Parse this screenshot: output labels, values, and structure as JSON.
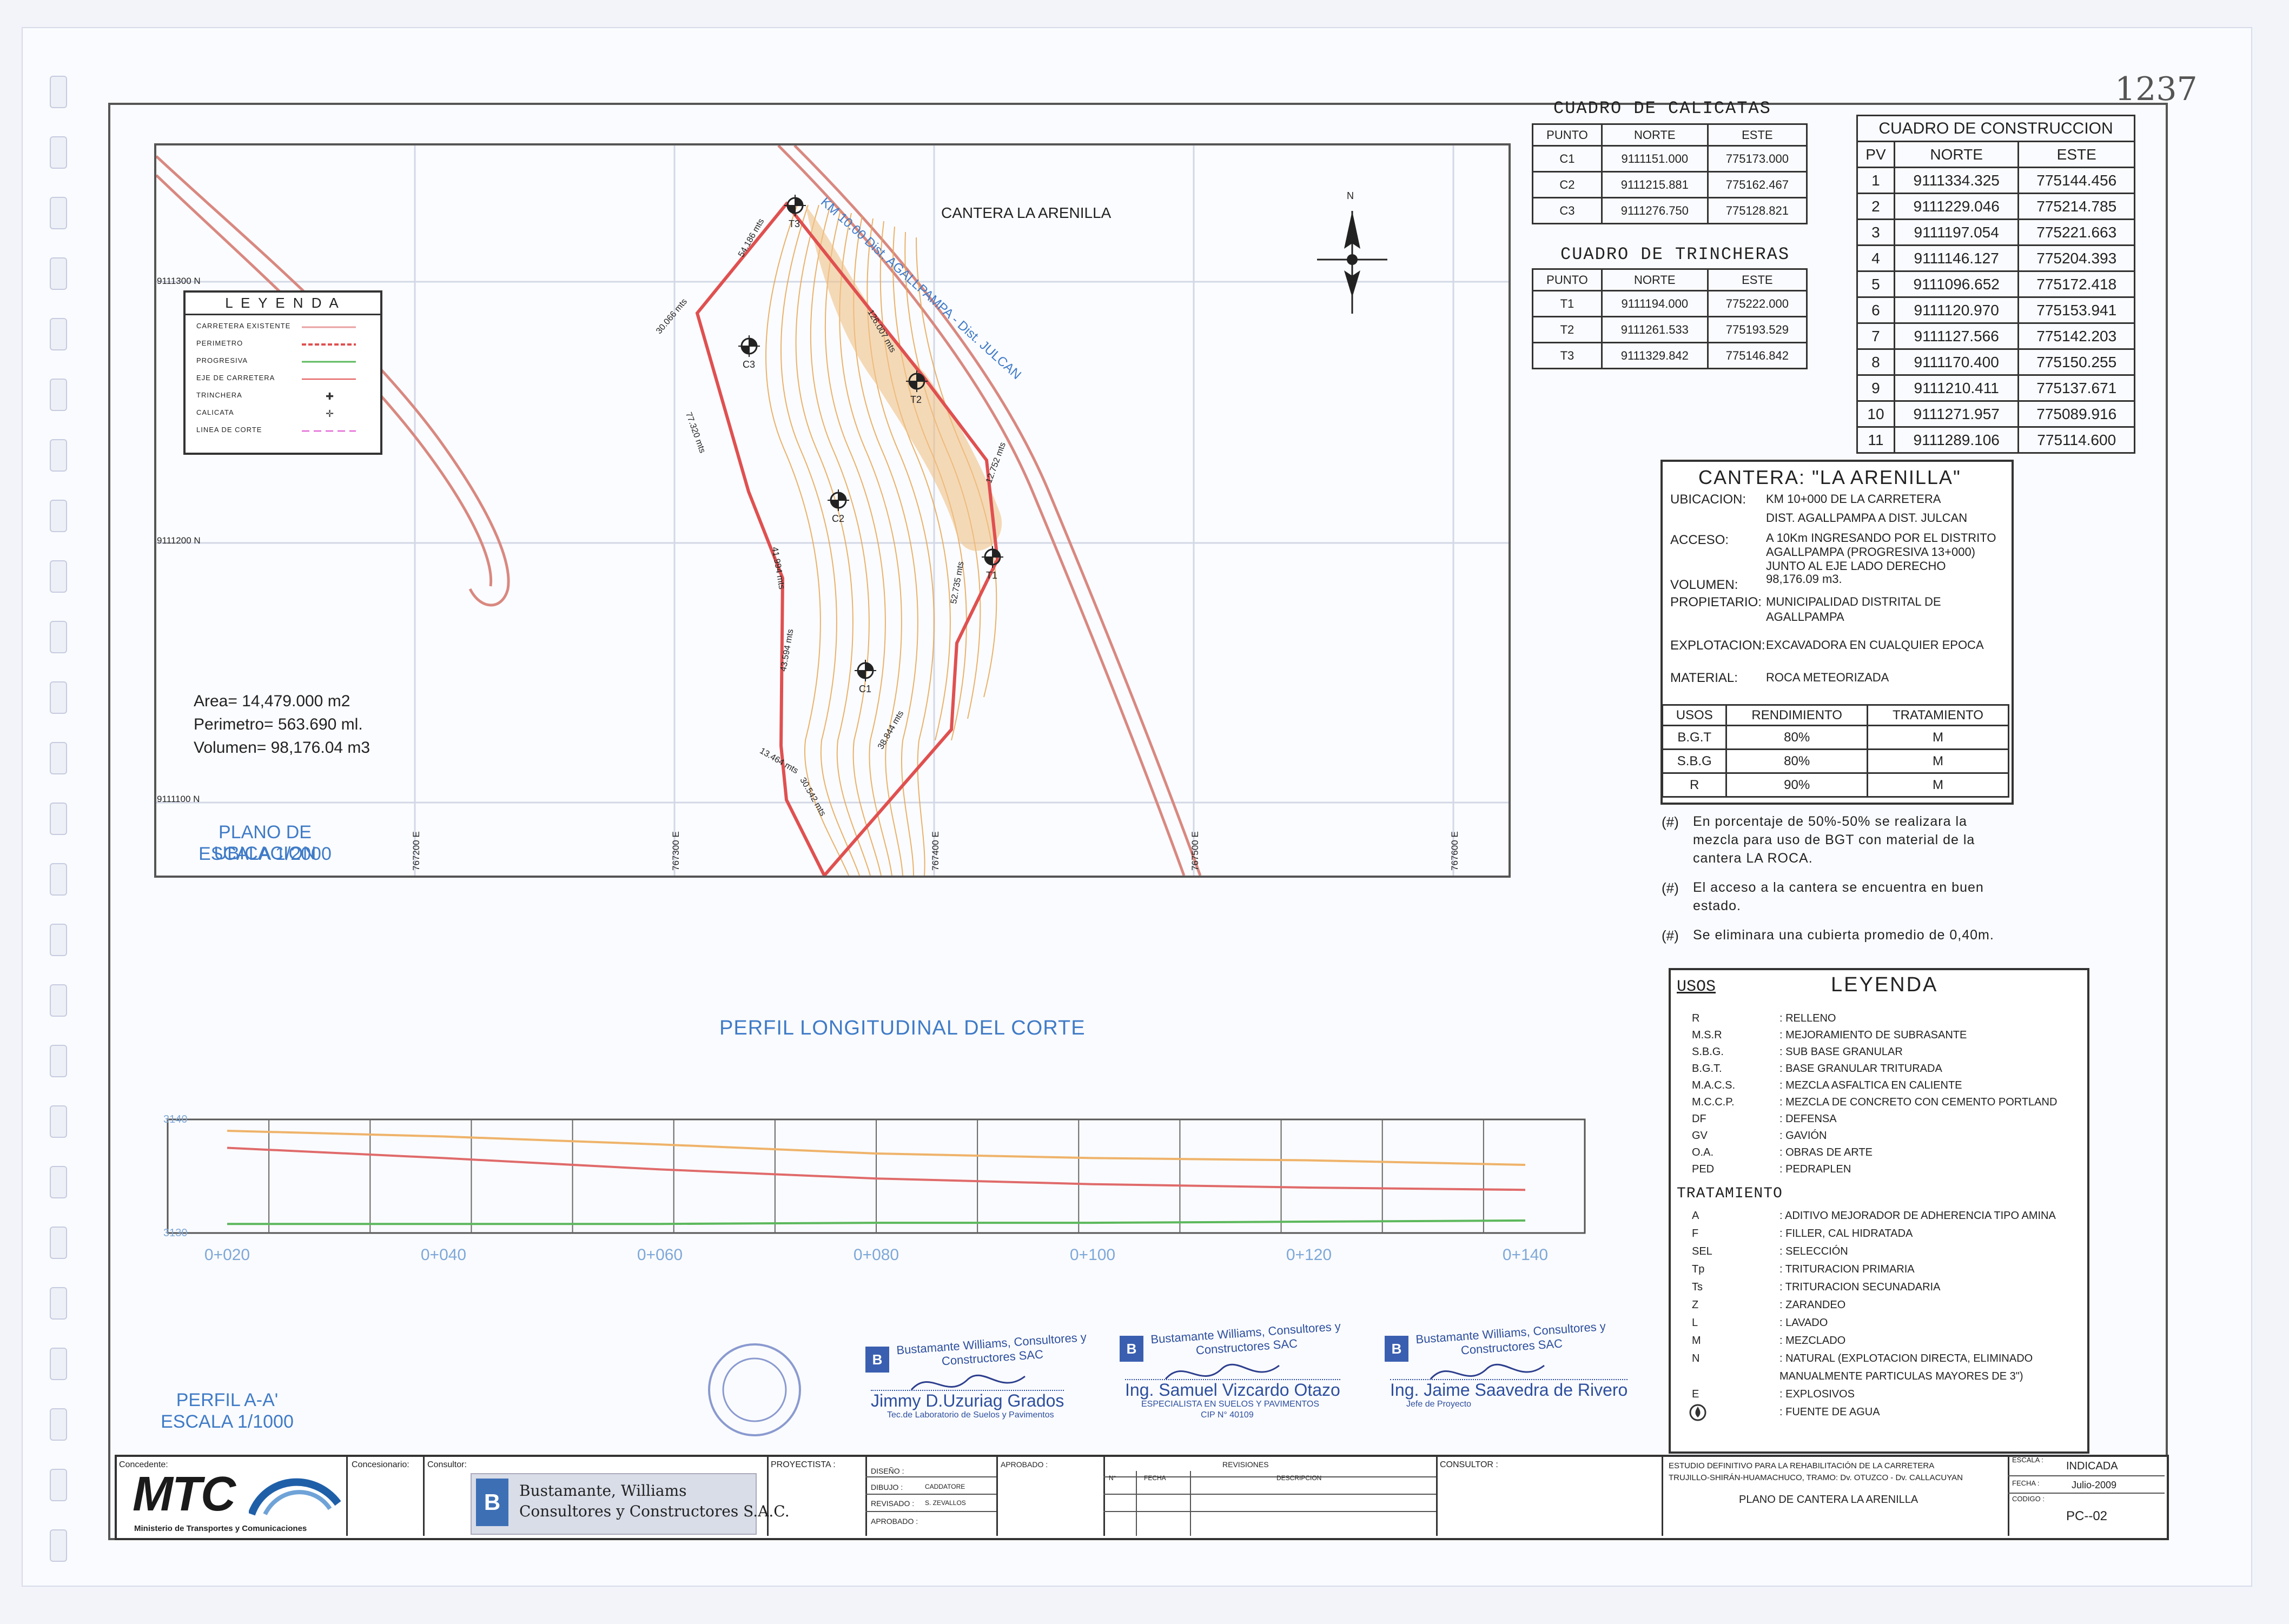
{
  "sheet_number": "1237",
  "calicatas": {
    "title": "CUADRO DE CALICATAS",
    "headers": [
      "PUNTO",
      "NORTE",
      "ESTE"
    ],
    "rows": [
      [
        "C1",
        "9111151.000",
        "775173.000"
      ],
      [
        "C2",
        "9111215.881",
        "775162.467"
      ],
      [
        "C3",
        "9111276.750",
        "775128.821"
      ]
    ]
  },
  "trincheras": {
    "title": "CUADRO DE TRINCHERAS",
    "headers": [
      "PUNTO",
      "NORTE",
      "ESTE"
    ],
    "rows": [
      [
        "T1",
        "9111194.000",
        "775222.000"
      ],
      [
        "T2",
        "9111261.533",
        "775193.529"
      ],
      [
        "T3",
        "9111329.842",
        "775146.842"
      ]
    ]
  },
  "construccion": {
    "title": "CUADRO DE CONSTRUCCION",
    "headers": [
      "PV",
      "NORTE",
      "ESTE"
    ],
    "rows": [
      [
        "1",
        "9111334.325",
        "775144.456"
      ],
      [
        "2",
        "9111229.046",
        "775214.785"
      ],
      [
        "3",
        "9111197.054",
        "775221.663"
      ],
      [
        "4",
        "9111146.127",
        "775204.393"
      ],
      [
        "5",
        "9111096.652",
        "775172.418"
      ],
      [
        "6",
        "9111120.970",
        "775153.941"
      ],
      [
        "7",
        "9111127.566",
        "775142.203"
      ],
      [
        "8",
        "9111170.400",
        "775150.255"
      ],
      [
        "9",
        "9111210.411",
        "775137.671"
      ],
      [
        "10",
        "9111271.957",
        "775089.916"
      ],
      [
        "11",
        "9111289.106",
        "775114.600"
      ]
    ]
  },
  "map": {
    "quarry_label": "CANTERA LA ARENILLA",
    "road_label": "KM 10.00 Dist. AGALLPAMPA - Dist. JULCAN",
    "north": "N",
    "grid_n": [
      "9111300 N",
      "9111200 N",
      "9111100 N"
    ],
    "grid_e": [
      "767200 E",
      "767300 E",
      "767400 E",
      "767500 E",
      "767600 E"
    ],
    "points": [
      "T3",
      "T2",
      "T1",
      "C3",
      "C2",
      "C1"
    ],
    "edge_labels": [
      "54.186 mts",
      "30.066 mts",
      "77.320 mts",
      "41.994 mts",
      "43.594 mts",
      "13.464 mts",
      "30.542 mts",
      "38.844 mts",
      "52.735 mts",
      "12.752 mts",
      "126.007 mts"
    ],
    "area": "Area= 14,479.000 m2",
    "perimetro": "Perimetro= 563.690 ml.",
    "volumen": "Volumen= 98,176.04 m3",
    "plano_title": "PLANO DE UBICACION",
    "plano_scale": "ESCALA 1/2000"
  },
  "map_legend": {
    "title": "L E Y E N D A",
    "items": [
      "CARRETERA EXISTENTE",
      "PERIMETRO",
      "PROGRESIVA",
      "EJE DE CARRETERA",
      "TRINCHERA",
      "CALICATA",
      "LINEA DE CORTE"
    ]
  },
  "cantera": {
    "title": "CANTERA:  \"LA ARENILLA\"",
    "ubicacion_label": "UBICACION:",
    "ubicacion": [
      "KM 10+000 DE LA CARRETERA",
      "DIST. AGALLPAMPA A DIST. JULCAN"
    ],
    "acceso_label": "ACCESO:",
    "acceso": [
      "A 10Km INGRESANDO POR EL DISTRITO",
      "AGALLPAMPA (PROGRESIVA 13+000)",
      "JUNTO AL EJE LADO DERECHO"
    ],
    "volumen_label": "VOLUMEN:",
    "volumen": "98,176.09  m3.",
    "propietario_label": "PROPIETARIO:",
    "propietario": [
      "MUNICIPALIDAD DISTRITAL DE",
      "AGALLPAMPA"
    ],
    "explotacion_label": "EXPLOTACION:",
    "explotacion": "EXCAVADORA EN CUALQUIER EPOCA",
    "material_label": "MATERIAL:",
    "material": "ROCA METEORIZADA",
    "usos_headers": [
      "USOS",
      "RENDIMIENTO",
      "TRATAMIENTO"
    ],
    "usos_rows": [
      [
        "B.G.T",
        "80%",
        "M"
      ],
      [
        "S.B.G",
        "80%",
        "M"
      ],
      [
        "R",
        "90%",
        "M"
      ]
    ]
  },
  "notes": [
    [
      "(#)",
      "En porcentaje de 50%-50% se realizara la",
      "mezcla para uso de BGT con material de la",
      "cantera LA ROCA."
    ],
    [
      "(#)",
      "El acceso a la cantera se encuentra en buen",
      "estado."
    ],
    [
      "(#)",
      "Se eliminara una cubierta promedio de 0,40m."
    ]
  ],
  "profile": {
    "title": "PERFIL LONGITUDINAL DEL CORTE",
    "y_labels": [
      "3140",
      "3130"
    ],
    "stations": [
      "0+020",
      "0+040",
      "0+060",
      "0+080",
      "0+100",
      "0+120",
      "0+140"
    ],
    "section_title": "PERFIL A-A'",
    "section_scale": "ESCALA 1/1000"
  },
  "chart_data": {
    "type": "line",
    "x": [
      "0+020",
      "0+040",
      "0+060",
      "0+080",
      "0+100",
      "0+120",
      "0+140"
    ],
    "ylim": [
      3130,
      3140
    ],
    "series": [
      {
        "values": [
          3139.0,
          3138.5,
          3137.8,
          3137.0,
          3136.6,
          3136.4,
          3136.0
        ]
      },
      {
        "values": [
          3137.5,
          3136.6,
          3135.6,
          3134.8,
          3134.3,
          3134.0,
          3133.8
        ]
      },
      {
        "values": [
          3130.8,
          3130.8,
          3130.8,
          3130.9,
          3130.9,
          3131.0,
          3131.1
        ]
      }
    ]
  },
  "legend_usos": {
    "usos_title": "USOS",
    "title": "LEYENDA",
    "usos": [
      [
        "R",
        ": RELLENO"
      ],
      [
        "M.S.R",
        ": MEJORAMIENTO DE SUBRASANTE"
      ],
      [
        "S.B.G.",
        ": SUB BASE GRANULAR"
      ],
      [
        "B.G.T.",
        ": BASE GRANULAR TRITURADA"
      ],
      [
        "M.A.C.S.",
        ": MEZCLA ASFALTICA EN CALIENTE"
      ],
      [
        "M.C.C.P.",
        ": MEZCLA DE CONCRETO CON CEMENTO PORTLAND"
      ],
      [
        "DF",
        ": DEFENSA"
      ],
      [
        "GV",
        ": GAVIÓN"
      ],
      [
        "O.A.",
        ": OBRAS DE ARTE"
      ],
      [
        "PED",
        ": PEDRAPLEN"
      ]
    ],
    "tratamiento_title": "TRATAMIENTO",
    "tratamiento": [
      [
        "A",
        ": ADITIVO MEJORADOR DE ADHERENCIA TIPO AMINA"
      ],
      [
        "F",
        ": FILLER, CAL HIDRATADA"
      ],
      [
        "SEL",
        ": SELECCIÓN"
      ],
      [
        "Tp",
        ": TRITURACION PRIMARIA"
      ],
      [
        "Ts",
        ": TRITURACION SECUNADARIA"
      ],
      [
        "Z",
        ": ZARANDEO"
      ],
      [
        "L",
        ": LAVADO"
      ],
      [
        "M",
        ": MEZCLADO"
      ],
      [
        "N",
        ": NATURAL (EXPLOTACION DIRECTA, ELIMINADO"
      ],
      [
        "",
        "MANUALMENTE PARTICULAS MAYORES DE 3\")"
      ],
      [
        "E",
        ": EXPLOSIVOS"
      ],
      [
        "",
        ": FUENTE DE AGUA"
      ]
    ]
  },
  "stamps": [
    {
      "company": "Bustamante Williams, Consultores y Constructores SAC",
      "name": "Jimmy D.Uzuriag Grados",
      "role": "Tec.de Laboratorio de Suelos y Pavimentos"
    },
    {
      "company": "Bustamante Williams, Consultores y Constructores SAC",
      "name": "Ing. Samuel Vizcardo Otazo",
      "role": "ESPECIALISTA EN SUELOS Y PAVIMENTOS",
      "cip": "CIP N° 40109"
    },
    {
      "company": "Bustamante Williams, Consultores y Constructores SAC",
      "name": "Ing. Jaime Saavedra de Rivero",
      "role": "Jefe de Proyecto"
    }
  ],
  "title_block": {
    "concedente": "Concedente:",
    "concesionario": "Concesionario:",
    "consultor": "Consultor:",
    "mtc": "MTC",
    "mtc_sub": "Ministerio de Transportes y Comunicaciones",
    "bw_line1": "Bustamante, Williams",
    "bw_line2": "Consultores y Constructores S.A.C.",
    "proyectista": "PROYECTISTA :",
    "diseno": "DISEÑO :",
    "dibujo": "DIBUJO :",
    "dibujo_val": "CADDATORE",
    "revisado": "REVISADO :",
    "revisado_val": "S. ZEVALLOS",
    "aprobado_l": "APROBADO :",
    "aprobado": "APROBADO :",
    "revisiones": "REVISIONES",
    "rev_cols": [
      "N°",
      "FECHA",
      "DESCRIPCION"
    ],
    "consultor2": "CONSULTOR :",
    "estudio": [
      "ESTUDIO DEFINITIVO PARA LA REHABILITACIÓN DE LA CARRETERA",
      "TRUJILLO-SHIRÁN-HUAMACHUCO, TRAMO: Dv. OTUZCO - Dv. CALLACUYAN"
    ],
    "plano": "PLANO DE CANTERA LA ARENILLA",
    "escala_l": "ESCALA :",
    "escala": "INDICADA",
    "fecha_l": "FECHA :",
    "fecha": "Julio-2009",
    "codigo_l": "CODIGO :",
    "codigo": "PC--02"
  }
}
